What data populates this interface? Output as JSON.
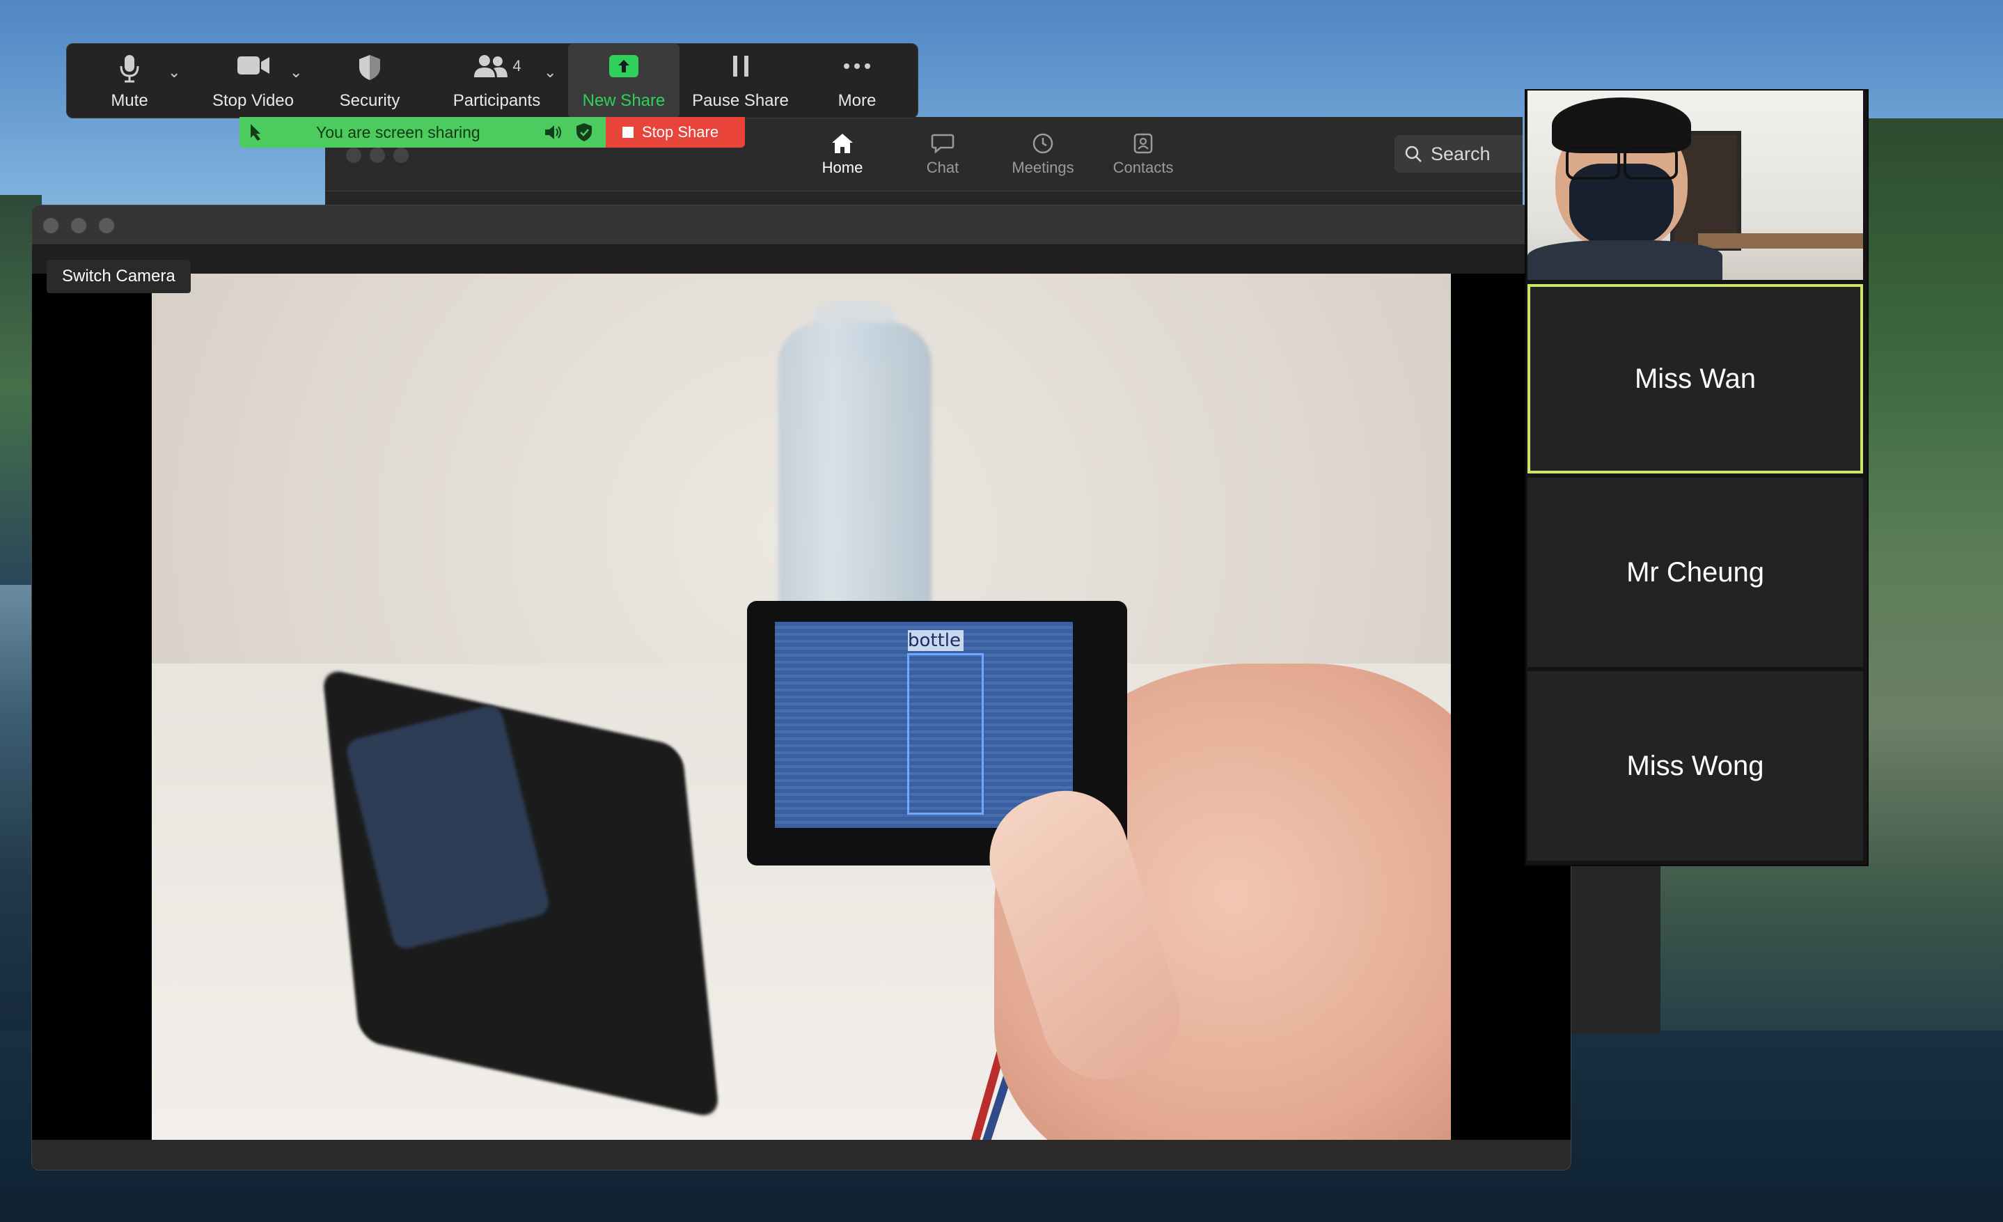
{
  "toolbar": {
    "items": [
      {
        "label": "Mute",
        "icon": "microphone-icon",
        "has_chevron": true
      },
      {
        "label": "Stop Video",
        "icon": "video-camera-icon",
        "has_chevron": true
      },
      {
        "label": "Security",
        "icon": "shield-icon",
        "has_chevron": false
      },
      {
        "label": "Participants",
        "icon": "participants-icon",
        "count": "4",
        "has_chevron": true
      },
      {
        "label": "New Share",
        "icon": "share-arrow-icon",
        "has_chevron": false,
        "active": true
      },
      {
        "label": "Pause Share",
        "icon": "pause-icon",
        "has_chevron": false
      },
      {
        "label": "More",
        "icon": "more-dots-icon",
        "has_chevron": false
      }
    ]
  },
  "sharing_bar": {
    "status_text": "You are screen sharing",
    "stop_label": "Stop Share",
    "colors": {
      "status_bg": "#4ccb5e",
      "stop_bg": "#e8443a"
    }
  },
  "main_nav": {
    "tabs": [
      {
        "label": "Home",
        "icon": "home-icon",
        "active": true
      },
      {
        "label": "Chat",
        "icon": "chat-bubble-icon"
      },
      {
        "label": "Meetings",
        "icon": "clock-icon"
      },
      {
        "label": "Contacts",
        "icon": "contacts-icon"
      }
    ],
    "search_label": "Search"
  },
  "camera_window": {
    "switch_camera_label": "Switch Camera",
    "detection_label": "bottle"
  },
  "participants": [
    {
      "name": "Miss Wan",
      "speaking": true
    },
    {
      "name": "Mr Cheung"
    },
    {
      "name": "Miss Wong"
    }
  ],
  "colors": {
    "active_share": "#2fd15b",
    "speaker_highlight": "#c9e66b",
    "toolbar_bg": "#242424"
  }
}
